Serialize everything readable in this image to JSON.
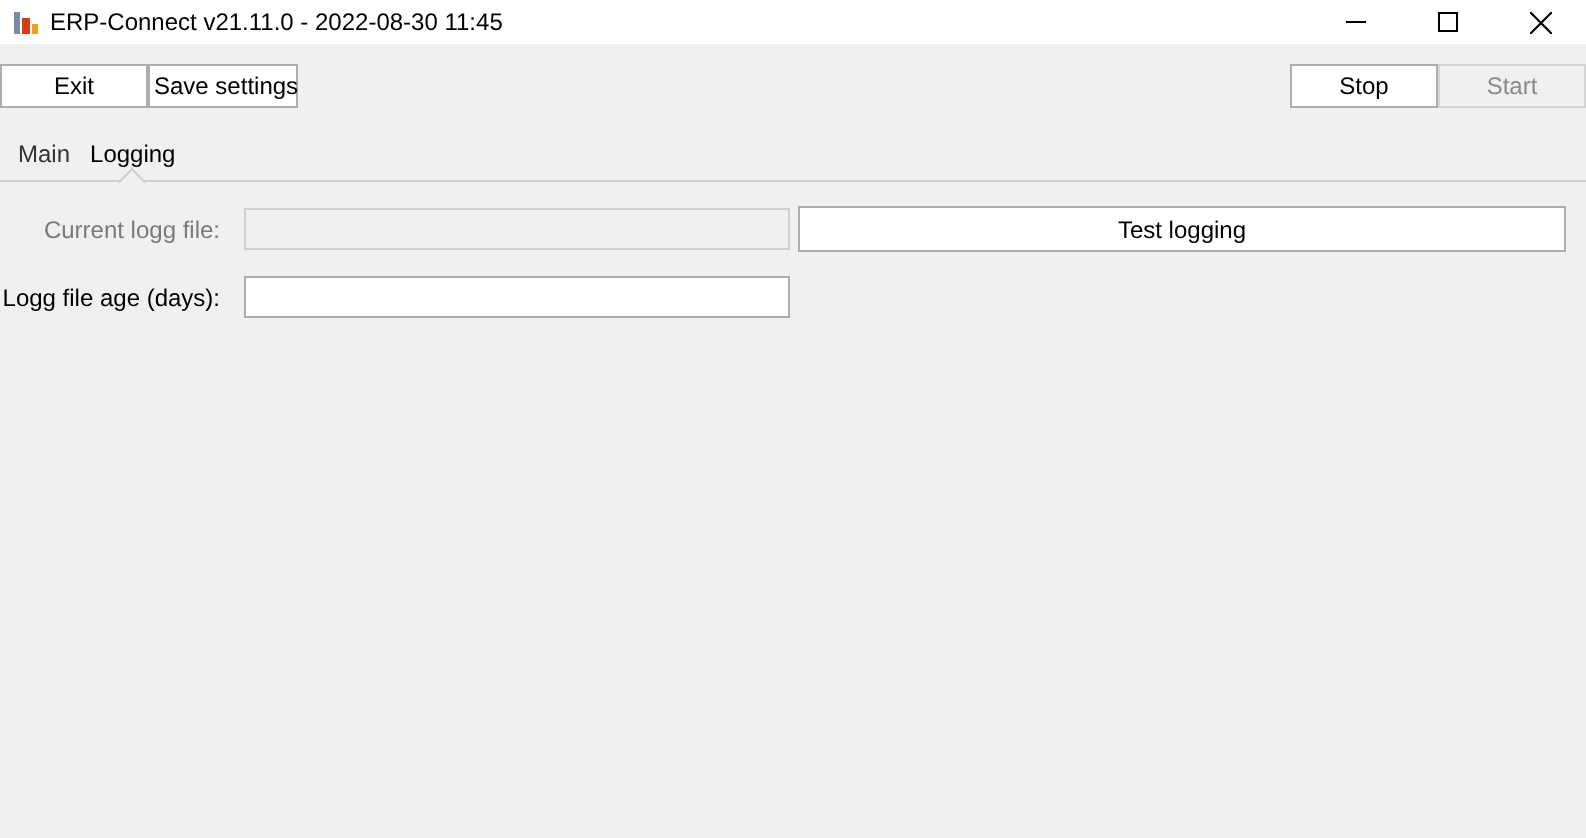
{
  "window": {
    "title": "ERP-Connect v21.11.0 - 2022-08-30 11:45"
  },
  "toolbar": {
    "left_buttons": [
      {
        "label": "Exit",
        "disabled": false
      },
      {
        "label": "Save settings",
        "disabled": false
      }
    ],
    "right_buttons": [
      {
        "label": "Stop",
        "disabled": false
      },
      {
        "label": "Start",
        "disabled": true
      }
    ]
  },
  "tabs": [
    {
      "label": "Main",
      "selected": false
    },
    {
      "label": "Logging",
      "selected": true
    }
  ],
  "logging": {
    "fields": [
      {
        "label": "Current logg file:",
        "disabled": true
      },
      {
        "label": "Logg file age (days):",
        "disabled": false
      }
    ],
    "test_button": {
      "label": "Test logging"
    }
  }
}
